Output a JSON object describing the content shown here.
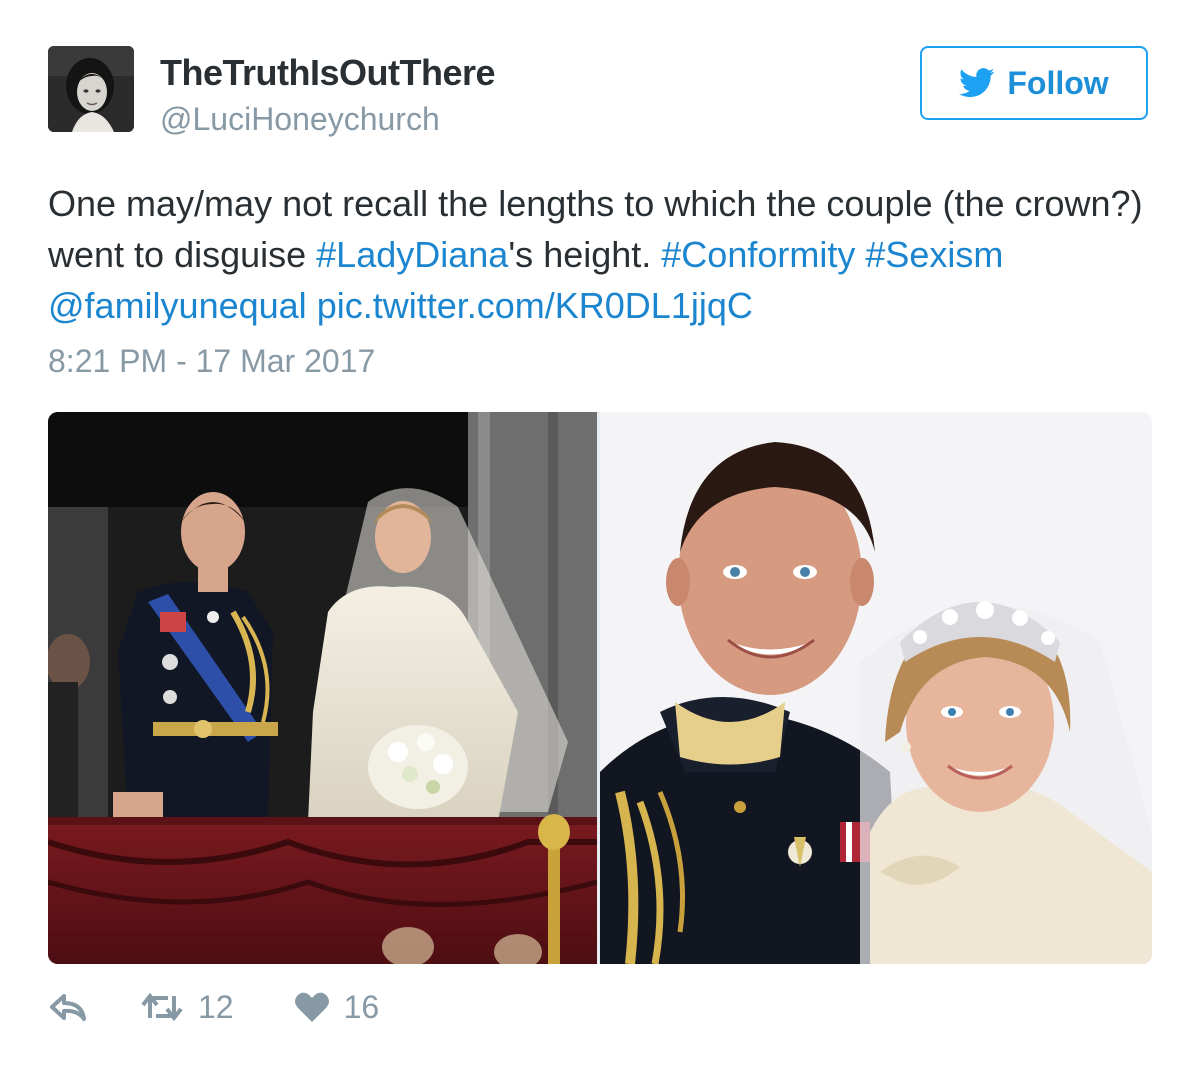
{
  "user": {
    "display_name": "TheTruthIsOutThere",
    "handle": "@LuciHoneychurch",
    "avatar_icon": "profile-photo"
  },
  "follow_button": {
    "label": "Follow",
    "icon": "twitter-bird-icon"
  },
  "tweet": {
    "text_before": "One may/may not recall the lengths to which the couple (the crown?) went to disguise ",
    "hashtag_ladydiana": "#LadyDiana",
    "text_middle": "'s height. ",
    "hashtag_conformity": "#Conformity",
    "hashtag_sexism": "#Sexism",
    "mention": "@familyunequal",
    "pic_link": "pic.twitter.com/KR0DL1jjqC",
    "timestamp": "8:21 PM - 17 Mar 2017"
  },
  "media": {
    "photos": [
      {
        "icon": "wedding-balcony-photo"
      },
      {
        "icon": "couple-portrait-photo"
      }
    ]
  },
  "actions": {
    "reply": {
      "icon": "reply-icon"
    },
    "retweet": {
      "icon": "retweet-icon",
      "count": "12"
    },
    "like": {
      "icon": "heart-icon",
      "count": "16"
    }
  },
  "colors": {
    "link": "#1b86cf",
    "muted": "#8899a6",
    "text": "#292f33",
    "follow_border": "#1da1f2"
  }
}
